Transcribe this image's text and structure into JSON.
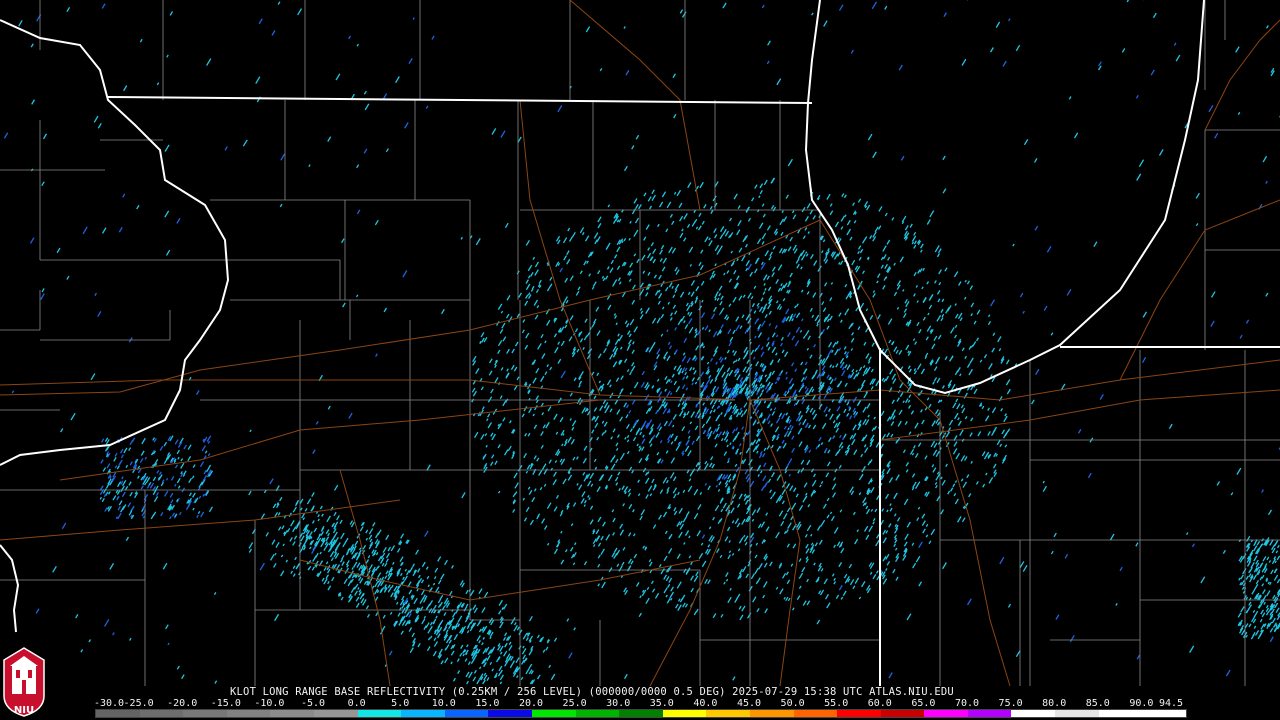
{
  "product": {
    "title": "KLOT LONG RANGE BASE REFLECTIVITY (0.25KM / 256 LEVEL) (000000/0000 0.5 DEG) 2025-07-29 15:38 UTC  ATLAS.NIU.EDU"
  },
  "legend": {
    "ticks": [
      "-30.0",
      "-25.0",
      "-20.0",
      "-15.0",
      "-10.0",
      "-5.0",
      "0.0",
      "5.0",
      "10.0",
      "15.0",
      "20.0",
      "25.0",
      "30.0",
      "35.0",
      "40.0",
      "45.0",
      "50.0",
      "55.0",
      "60.0",
      "65.0",
      "70.0",
      "75.0",
      "80.0",
      "85.0",
      "90.0",
      "94.5"
    ],
    "colors": [
      "#646464",
      "#6e6e6e",
      "#787878",
      "#828282",
      "#8c8c8c",
      "#969696",
      "#14e6e6",
      "#0ab4ff",
      "#0a64ff",
      "#0a0ae6",
      "#00e600",
      "#00b400",
      "#008200",
      "#ffff00",
      "#ffc800",
      "#ff9600",
      "#ff6400",
      "#ff0000",
      "#c80000",
      "#ff00ff",
      "#b400ff",
      "#ffffff",
      "#e6e6e6",
      "#ffffff",
      "#ffffff"
    ]
  },
  "logo": {
    "text": "NIU",
    "color": "#c8102e"
  },
  "map_colors": {
    "state_border": "#ffffff",
    "county_border": "#8a8a8a",
    "road": "#8b4513",
    "echo_light": "#1ec8e6",
    "echo_dark": "#1e64e6",
    "radar_site": "#000000"
  }
}
